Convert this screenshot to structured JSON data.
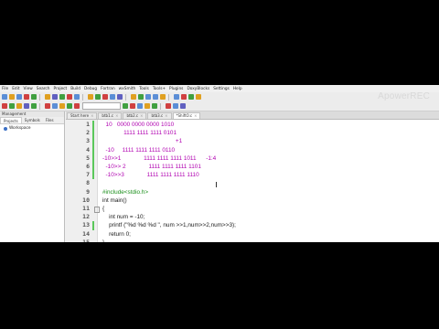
{
  "menu": [
    "File",
    "Edit",
    "View",
    "Search",
    "Project",
    "Build",
    "Debug",
    "Fortran",
    "wxSmith",
    "Tools",
    "Tools+",
    "Plugins",
    "DoxyBlocks",
    "Settings",
    "Help"
  ],
  "watermark": "ApowerREC",
  "management": {
    "title": "Management",
    "tabs": [
      "Projects",
      "Symbols",
      "Files"
    ],
    "workspace": "Workspace"
  },
  "editor_tabs": [
    {
      "label": "Start here",
      "active": false
    },
    {
      "label": "btb1.c",
      "active": false
    },
    {
      "label": "btb2.c",
      "active": false
    },
    {
      "label": "btb3.c",
      "active": false
    },
    {
      "label": "*ShiftO.c",
      "active": true
    }
  ],
  "code_lines": [
    {
      "num": "1",
      "text": "  10   0000 0000 0000 1010",
      "style": "comment",
      "changed": true
    },
    {
      "num": "2",
      "text": "             1111 1111 1111 0101",
      "style": "comment",
      "changed": true
    },
    {
      "num": "3",
      "text": "                                             +1",
      "style": "comment",
      "changed": true
    },
    {
      "num": "4",
      "text": "  -10     1111 1111 1111 0110",
      "style": "comment",
      "changed": true
    },
    {
      "num": "5",
      "text": "-10>>1              1111 1111 1111 1011      -1:4",
      "style": "comment",
      "changed": true
    },
    {
      "num": "6",
      "text": "  -10>> 2              1111 1111 1111 1101",
      "style": "comment",
      "changed": true
    },
    {
      "num": "7",
      "text": "  -10>>3              1111 1111 1111 1110",
      "style": "comment",
      "changed": true
    },
    {
      "num": "8",
      "text": "",
      "style": "code",
      "changed": false
    },
    {
      "num": "9",
      "text": "#include<stdio.h>",
      "style": "pre",
      "changed": false
    },
    {
      "num": "10",
      "text": "int main()",
      "style": "code",
      "changed": false
    },
    {
      "num": "11",
      "text": "{",
      "style": "code",
      "changed": false
    },
    {
      "num": "12",
      "text": "    int num = -10;",
      "style": "code",
      "changed": false
    },
    {
      "num": "13",
      "text": "    printf (\"%d %d %d \", num >>1,num>>2,num>>3);",
      "style": "code",
      "changed": true
    },
    {
      "num": "14",
      "text": "    return 0;",
      "style": "code",
      "changed": false
    },
    {
      "num": "15",
      "text": "}",
      "style": "code",
      "changed": false
    }
  ],
  "colors": {
    "comment": "#b000b0",
    "preprocessor": "#1a8f1a",
    "change_marker": "#5bc85b"
  },
  "toolbar_icon_colors": [
    "#5b8ed6",
    "#e0a020",
    "#5b8ed6",
    "#d04040",
    "#40a040",
    "#e0a020",
    "#6060c0",
    "#40a040",
    "#d04040",
    "#5b8ed6",
    "#e0a020",
    "#40a040",
    "#d04040",
    "#5b8ed6",
    "#6060c0",
    "#e0a020",
    "#40a040",
    "#5b8ed6"
  ]
}
